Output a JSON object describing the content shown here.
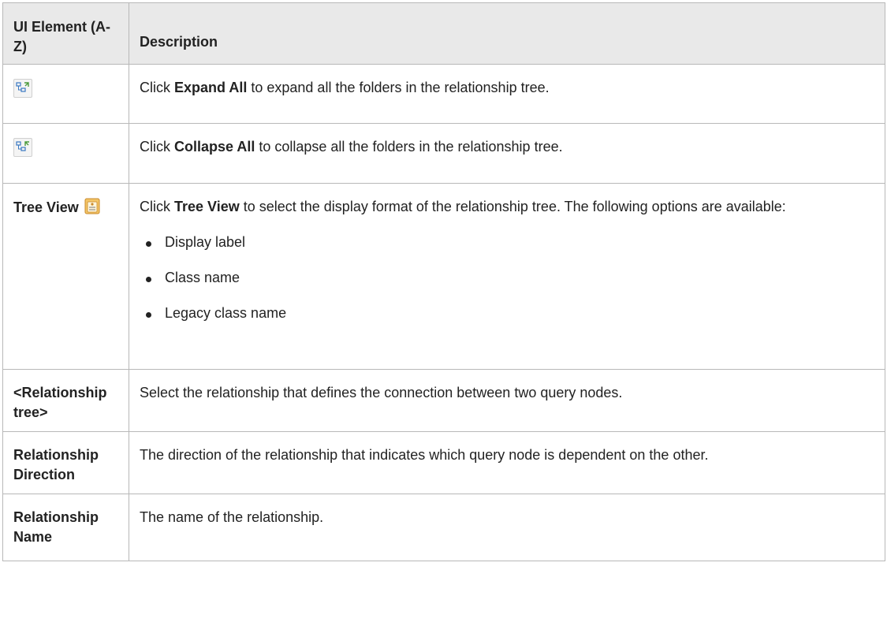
{
  "table": {
    "header": {
      "col1": "UI Element (A-Z)",
      "col2": "Description"
    },
    "rows": {
      "expand": {
        "icon": "expand-all-icon",
        "pre": "Click ",
        "bold": "Expand All",
        "post": " to expand all the folders in the relationship tree."
      },
      "collapse": {
        "icon": "collapse-all-icon",
        "pre": "Click ",
        "bold": "Collapse All",
        "post": " to collapse all the folders in the relationship tree."
      },
      "treeview": {
        "element": "Tree View",
        "icon": "tree-view-icon",
        "pre": "Click ",
        "bold": "Tree View",
        "post": " to select the display format of the relationship tree. The following options are available:",
        "options": [
          "Display label",
          "Class name",
          "Legacy class name"
        ]
      },
      "reltree": {
        "element": "<Relationship tree>",
        "desc": "Select the relationship that defines the connection between two query nodes."
      },
      "reldir": {
        "element": "Relationship Direction",
        "desc": "The direction of the relationship that indicates which query node is dependent on the other."
      },
      "relname": {
        "element": "Relationship Name",
        "desc": "The name of the relationship."
      }
    }
  },
  "colors": {
    "header_bg": "#e9e9e9",
    "border": "#b8b8b8",
    "text": "#222222",
    "icon_blue": "#3a78c2",
    "icon_green": "#4a9a3a",
    "tag_orange": "#e8a33a"
  }
}
